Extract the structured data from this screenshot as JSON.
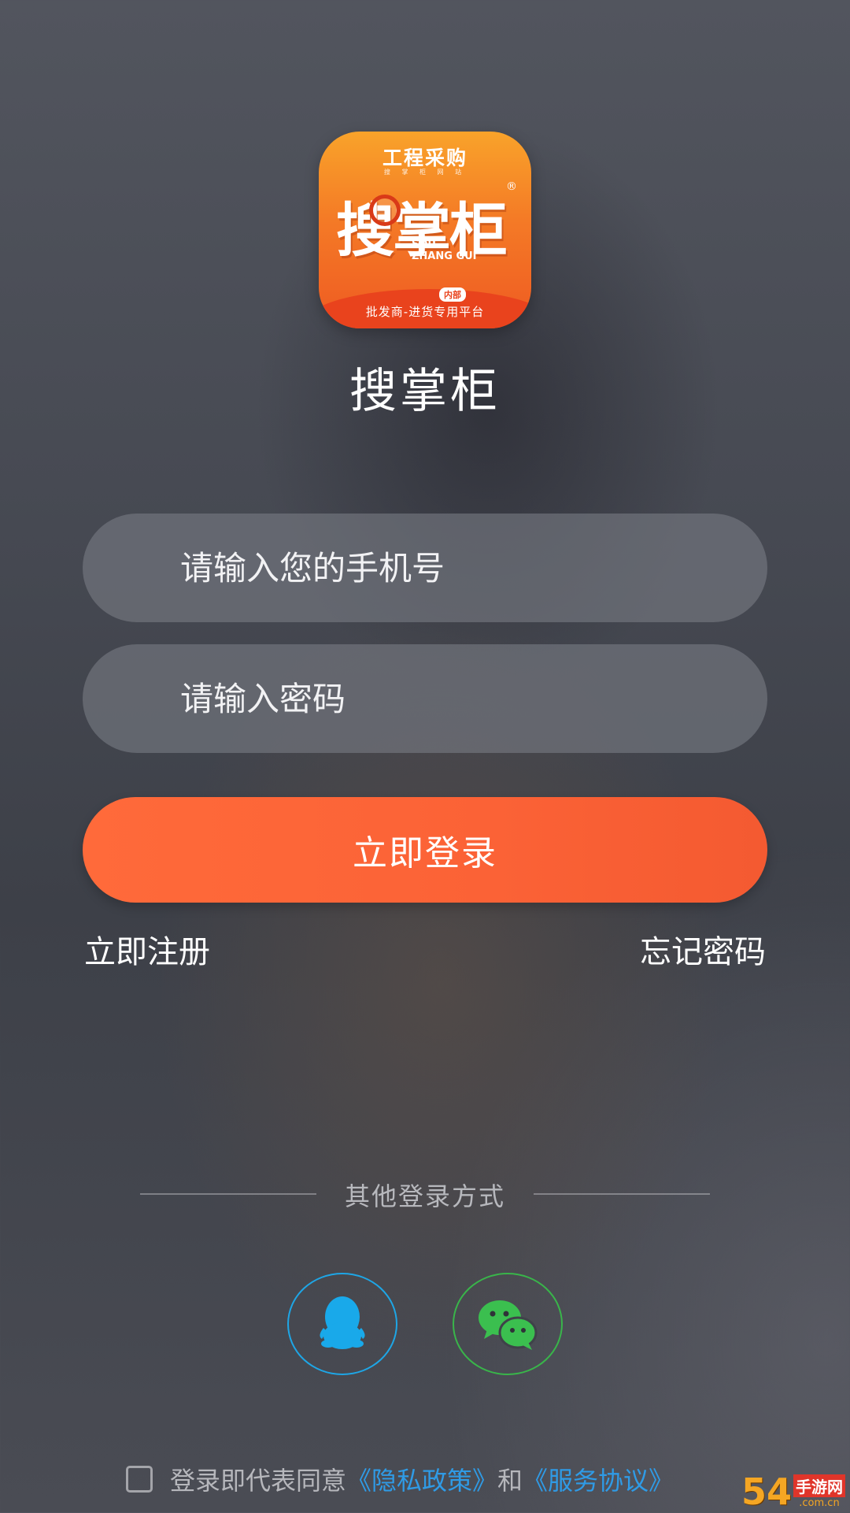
{
  "app_icon": {
    "top_text": "工程采购",
    "sub_text": "搜 掌 柜 网 站",
    "brand_text": "搜掌柜",
    "reg_mark": "®",
    "pinyin_line1": "SOU",
    "pinyin_line2": "ZHANG GUI",
    "tag": "内部",
    "bottom_text": "批发商-进货专用平台"
  },
  "app_name": "搜掌柜",
  "form": {
    "phone_placeholder": "请输入您的手机号",
    "phone_value": "",
    "password_placeholder": "请输入密码",
    "password_value": "",
    "login_label": "立即登录"
  },
  "links": {
    "register": "立即注册",
    "forgot_password": "忘记密码"
  },
  "other_login": {
    "label": "其他登录方式",
    "methods": [
      {
        "name": "QQ",
        "icon": "qq-penguin-icon",
        "color": "#1ea6e6"
      },
      {
        "name": "WeChat",
        "icon": "wechat-icon",
        "color": "#39b54a"
      }
    ]
  },
  "agreement": {
    "prefix": "登录即代表同意",
    "privacy": "《隐私政策》",
    "and": "和",
    "service": "《服务协议》",
    "checked": false
  },
  "watermark": {
    "logo": "54",
    "cn": "手游网",
    "url": ".com.cn"
  },
  "colors": {
    "accent": "#fb6236",
    "link": "#2f9be6",
    "qq": "#1ea6e6",
    "wechat": "#39b54a"
  }
}
